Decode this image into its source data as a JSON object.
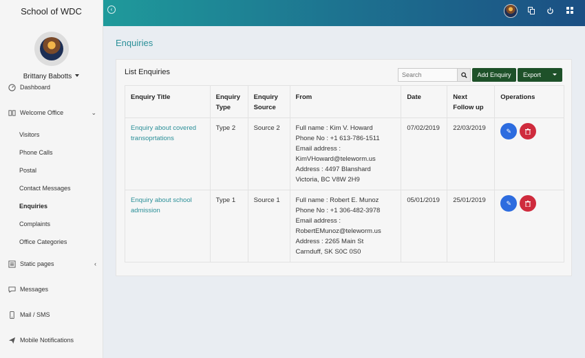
{
  "app": {
    "brand": "School of WDC",
    "user_name": "Brittany Babotts"
  },
  "sidebar": {
    "items": [
      {
        "label": "Dashboard",
        "icon": "dashboard-icon"
      },
      {
        "label": "Welcome Office",
        "icon": "book-icon",
        "expanded": true
      },
      {
        "label": "Static pages",
        "icon": "pages-icon",
        "expanded": false
      },
      {
        "label": "Messages",
        "icon": "chat-icon"
      },
      {
        "label": "Mail / SMS",
        "icon": "phone-icon"
      },
      {
        "label": "Mobile Notifications",
        "icon": "send-icon"
      }
    ],
    "submenu": [
      "Visitors",
      "Phone Calls",
      "Postal",
      "Contact Messages",
      "Enquiries",
      "Complaints",
      "Office Categories"
    ],
    "active_submenu": "Enquiries"
  },
  "topbar": {
    "icons": [
      "back-circle-icon",
      "user-avatar",
      "translate-icon",
      "power-icon",
      "grid-icon"
    ]
  },
  "page": {
    "title": "Enquiries"
  },
  "card": {
    "title": "List Enquiries",
    "search_placeholder": "Search",
    "add_button": "Add Enquiry",
    "export_button": "Export",
    "columns": [
      "Enquiry Title",
      "Enquiry Type",
      "Enquiry Source",
      "From",
      "Date",
      "Next Follow up",
      "Operations"
    ],
    "rows": [
      {
        "title": "Enquiry about covered transoprtations",
        "type": "Type 2",
        "source": "Source 2",
        "from_name": "Full name : Kim V. Howard",
        "from_phone": "Phone No : +1 613-786-1511",
        "from_email_label": "Email address :",
        "from_email": "KimVHoward@teleworm.us",
        "from_address1": "Address : 4497 Blanshard",
        "from_address2": "Victoria, BC V8W 2H9",
        "date": "07/02/2019",
        "follow_up": "22/03/2019"
      },
      {
        "title": "Enquiry about school admission",
        "type": "Type 1",
        "source": "Source 1",
        "from_name": "Full name : Robert E. Munoz",
        "from_phone": "Phone No : +1 306-482-3978",
        "from_email_label": "Email address :",
        "from_email": "RobertEMunoz@teleworm.us",
        "from_address1": "Address : 2265 Main St",
        "from_address2": "Carnduff, SK S0C 0S0",
        "date": "05/01/2019",
        "follow_up": "25/01/2019"
      }
    ]
  },
  "colors": {
    "accent": "#2a8f98",
    "button_green": "#1e5129",
    "edit_blue": "#2d6cdf",
    "delete_red": "#cf2b3d"
  }
}
